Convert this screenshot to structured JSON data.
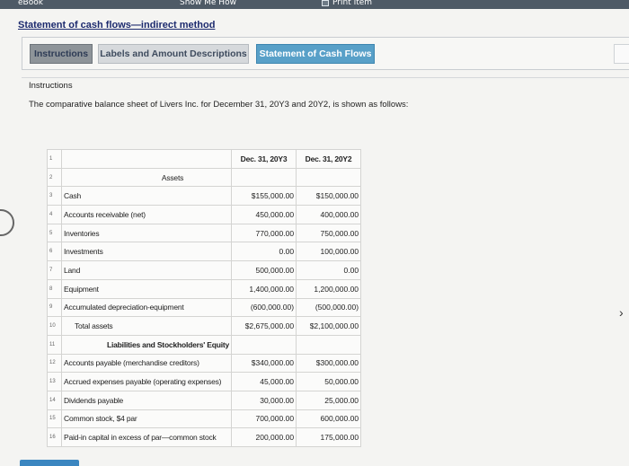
{
  "topbar": {
    "ebook": "eBook",
    "show_me": "Show Me How",
    "print_item": "Print Item"
  },
  "page_title": "Statement of cash flows—indirect method",
  "tabs": {
    "instructions": "Instructions",
    "labels": "Labels and Amount Descriptions",
    "statement": "Statement of Cash Flows"
  },
  "instructions": {
    "heading": "Instructions",
    "text": "The comparative balance sheet of Livers Inc. for December 31, 20Y3 and 20Y2, is shown as follows:"
  },
  "table": {
    "col_headers": [
      "Dec. 31, 20Y3",
      "Dec. 31, 20Y2"
    ],
    "rows": [
      {
        "num": "1",
        "label": "",
        "v1": "",
        "v2": ""
      },
      {
        "num": "2",
        "label": "Assets",
        "v1": "",
        "v2": ""
      },
      {
        "num": "3",
        "label": "Cash",
        "v1": "$155,000.00",
        "v2": "$150,000.00"
      },
      {
        "num": "4",
        "label": "Accounts receivable (net)",
        "v1": "450,000.00",
        "v2": "400,000.00"
      },
      {
        "num": "5",
        "label": "Inventories",
        "v1": "770,000.00",
        "v2": "750,000.00"
      },
      {
        "num": "6",
        "label": "Investments",
        "v1": "0.00",
        "v2": "100,000.00"
      },
      {
        "num": "7",
        "label": "Land",
        "v1": "500,000.00",
        "v2": "0.00"
      },
      {
        "num": "8",
        "label": "Equipment",
        "v1": "1,400,000.00",
        "v2": "1,200,000.00"
      },
      {
        "num": "9",
        "label": "Accumulated depreciation-equipment",
        "v1": "(600,000.00)",
        "v2": "(500,000.00)"
      },
      {
        "num": "10",
        "label": "Total assets",
        "v1": "$2,675,000.00",
        "v2": "$2,100,000.00"
      },
      {
        "num": "11",
        "label": "Liabilities and Stockholders' Equity",
        "v1": "",
        "v2": ""
      },
      {
        "num": "12",
        "label": "Accounts payable (merchandise creditors)",
        "v1": "$340,000.00",
        "v2": "$300,000.00"
      },
      {
        "num": "13",
        "label": "Accrued expenses payable (operating expenses)",
        "v1": "45,000.00",
        "v2": "50,000.00"
      },
      {
        "num": "14",
        "label": "Dividends payable",
        "v1": "30,000.00",
        "v2": "25,000.00"
      },
      {
        "num": "15",
        "label": "Common stock, $4 par",
        "v1": "700,000.00",
        "v2": "600,000.00"
      },
      {
        "num": "16",
        "label": "Paid-in capital in excess of par—common stock",
        "v1": "200,000.00",
        "v2": "175,000.00"
      }
    ]
  }
}
